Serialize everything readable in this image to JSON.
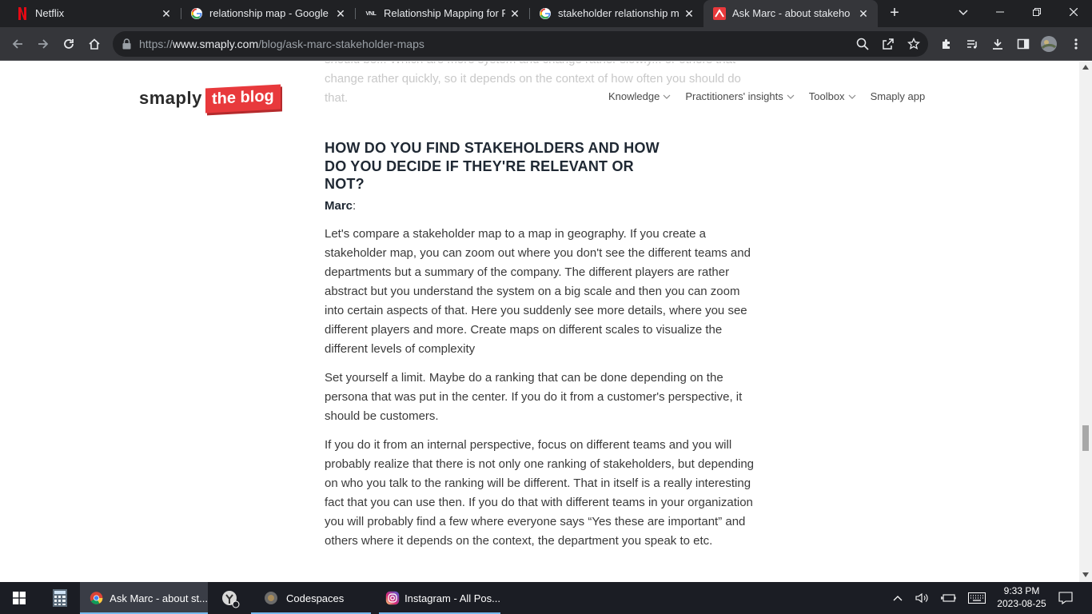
{
  "browser": {
    "tabs": [
      {
        "title": "Netflix",
        "icon": "netflix-icon",
        "active": false
      },
      {
        "title": "relationship map - Google Se",
        "icon": "google-icon",
        "active": false
      },
      {
        "title": "Relationship Mapping for Pul",
        "icon": "vnl-icon",
        "active": false
      },
      {
        "title": "stakeholder relationship map",
        "icon": "google-icon",
        "active": false
      },
      {
        "title": "Ask Marc - about stakeholde",
        "icon": "smaply-icon",
        "active": true
      }
    ],
    "vnl_label": "VNL",
    "url_prefix": "https://",
    "url_domain": "www.smaply.com",
    "url_path": "/blog/ask-marc-stakeholder-maps"
  },
  "site": {
    "logo_word": "smaply",
    "logo_badge": "the blog",
    "nav": [
      {
        "label": "Knowledge",
        "dropdown": true
      },
      {
        "label": "Practitioners' insights",
        "dropdown": true
      },
      {
        "label": "Toolbox",
        "dropdown": true
      },
      {
        "label": "Smaply app",
        "dropdown": false
      }
    ]
  },
  "article": {
    "faded_text": "should be... Which are more system and change rather slowly... or others that change rather quickly, so it depends on the context of how often you should do that.",
    "heading": "HOW DO YOU FIND STAKEHOLDERS AND HOW DO YOU DECIDE IF THEY'RE RELEVANT OR NOT?",
    "author_name": "Marc",
    "author_suffix": ":",
    "paragraphs": [
      "Let's compare a stakeholder map to a map in geography. If you create a stakeholder map, you can zoom out where you don't see the different teams and departments but a summary of the company. The different players are rather abstract but you understand the system on a big scale and then you can zoom into certain aspects of that. Here you suddenly see more details, where you see different players and more. Create maps on different scales to visualize the different levels of complexity",
      "Set yourself a limit. Maybe do a ranking that can be done depending on the persona that was put in the center. If you do it from a customer's perspective, it should be customers.",
      "If you do it from an internal perspective, focus on different teams and you will probably realize that there is not only one ranking of stakeholders, but depending on who you talk to the ranking will be different. That in itself is a really interesting fact that you can use then. If you do that with different teams in your organization you will probably find a few where everyone says “Yes these are important” and others where it depends on the context, the department you speak to etc."
    ]
  },
  "taskbar": {
    "apps": [
      {
        "label": "Ask Marc - about st...",
        "icon": "chrome-icon"
      },
      {
        "label": "Codespaces",
        "icon": "codespaces-icon"
      },
      {
        "label": "Instagram - All Pos...",
        "icon": "instagram-icon"
      }
    ],
    "time": "9:33 PM",
    "date": "2023-08-25"
  },
  "colors": {
    "brand_red": "#e8393c",
    "chrome_dark": "#202124",
    "chrome_toolbar": "#35363a",
    "taskbar": "#1b1d24",
    "taskbar_accent": "#76b9ed"
  }
}
